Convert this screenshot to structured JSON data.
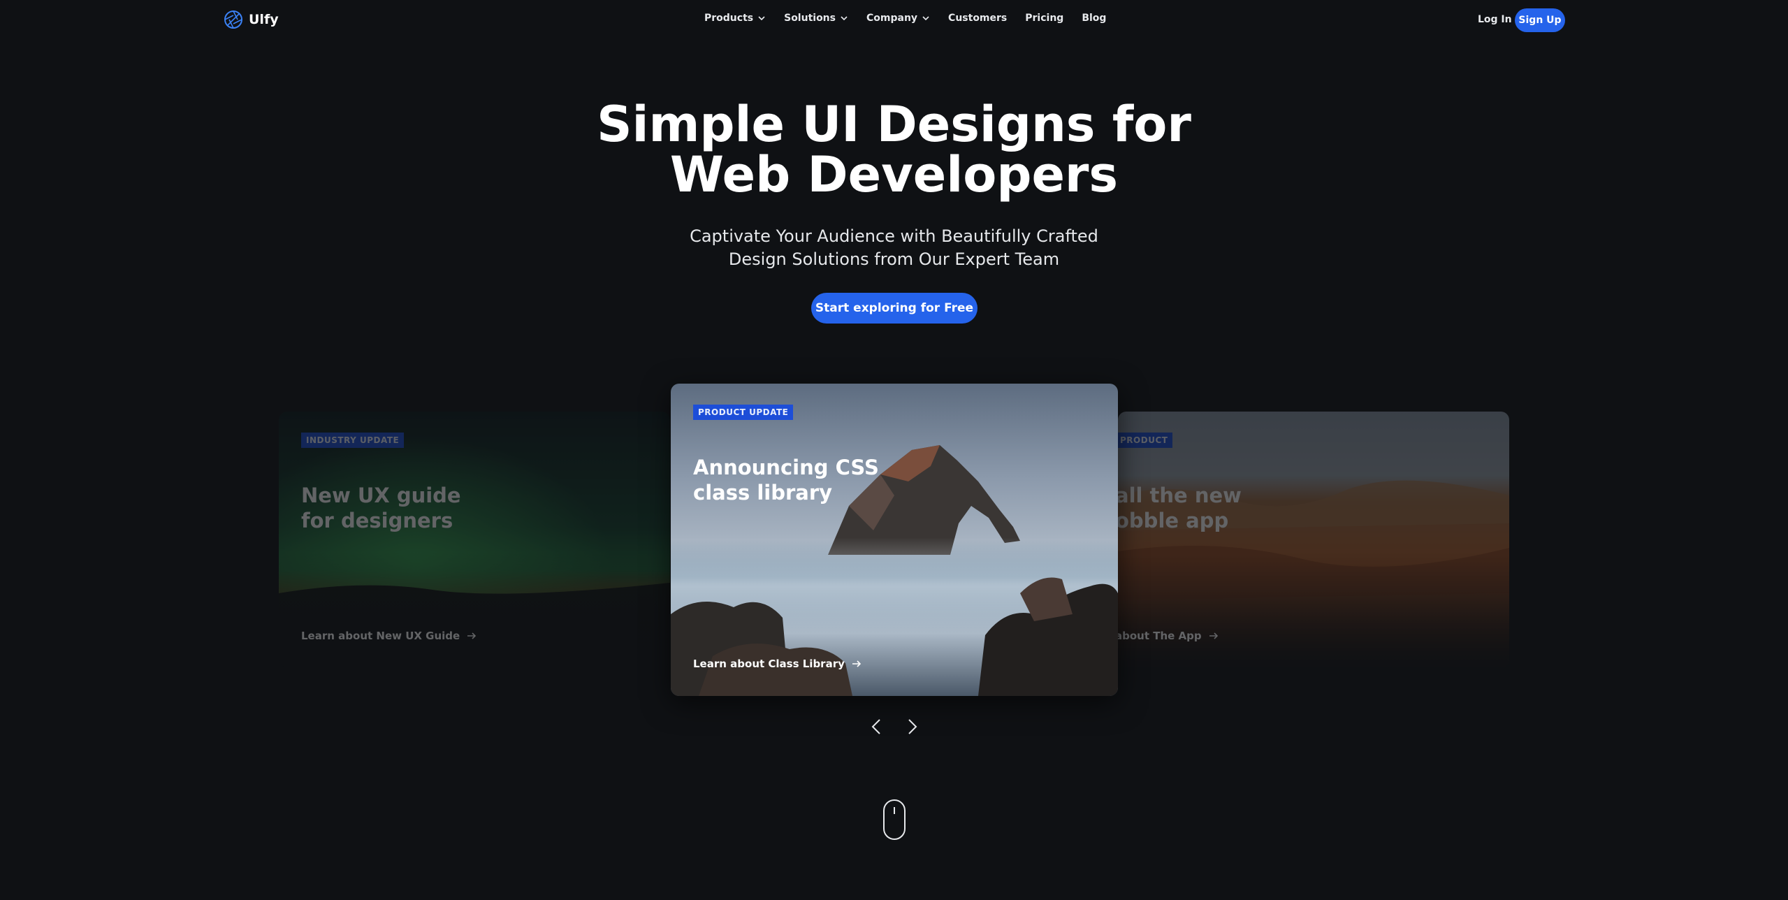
{
  "brand": {
    "name": "Ulfy",
    "accent": "#2563eb"
  },
  "nav": {
    "items": [
      {
        "label": "Products",
        "dropdown": true
      },
      {
        "label": "Solutions",
        "dropdown": true
      },
      {
        "label": "Company",
        "dropdown": true
      },
      {
        "label": "Customers",
        "dropdown": false
      },
      {
        "label": "Pricing",
        "dropdown": false
      },
      {
        "label": "Blog",
        "dropdown": false
      }
    ],
    "login": "Log In",
    "signup": "Sign Up"
  },
  "hero": {
    "title_line1": "Simple UI Designs for",
    "title_line2": "Web Developers",
    "subtitle_line1": "Captivate Your Audience with Beautifully Crafted",
    "subtitle_line2": "Design Solutions from Our Expert Team",
    "cta": "Start exploring for Free"
  },
  "carousel": {
    "cards": [
      {
        "tag": "INDUSTRY UPDATE",
        "title_line1": "New UX guide",
        "title_line2": "for designers",
        "link": "Learn about New UX Guide",
        "state": "inactive"
      },
      {
        "tag": "PRODUCT UPDATE",
        "title_line1": "Announcing CSS",
        "title_line2": "class library",
        "link": "Learn about Class Library",
        "state": "active"
      },
      {
        "tag": "PRODUCT",
        "title_line1": "all the new",
        "title_line2": "obble app",
        "link": "about The App",
        "state": "inactive"
      }
    ]
  }
}
